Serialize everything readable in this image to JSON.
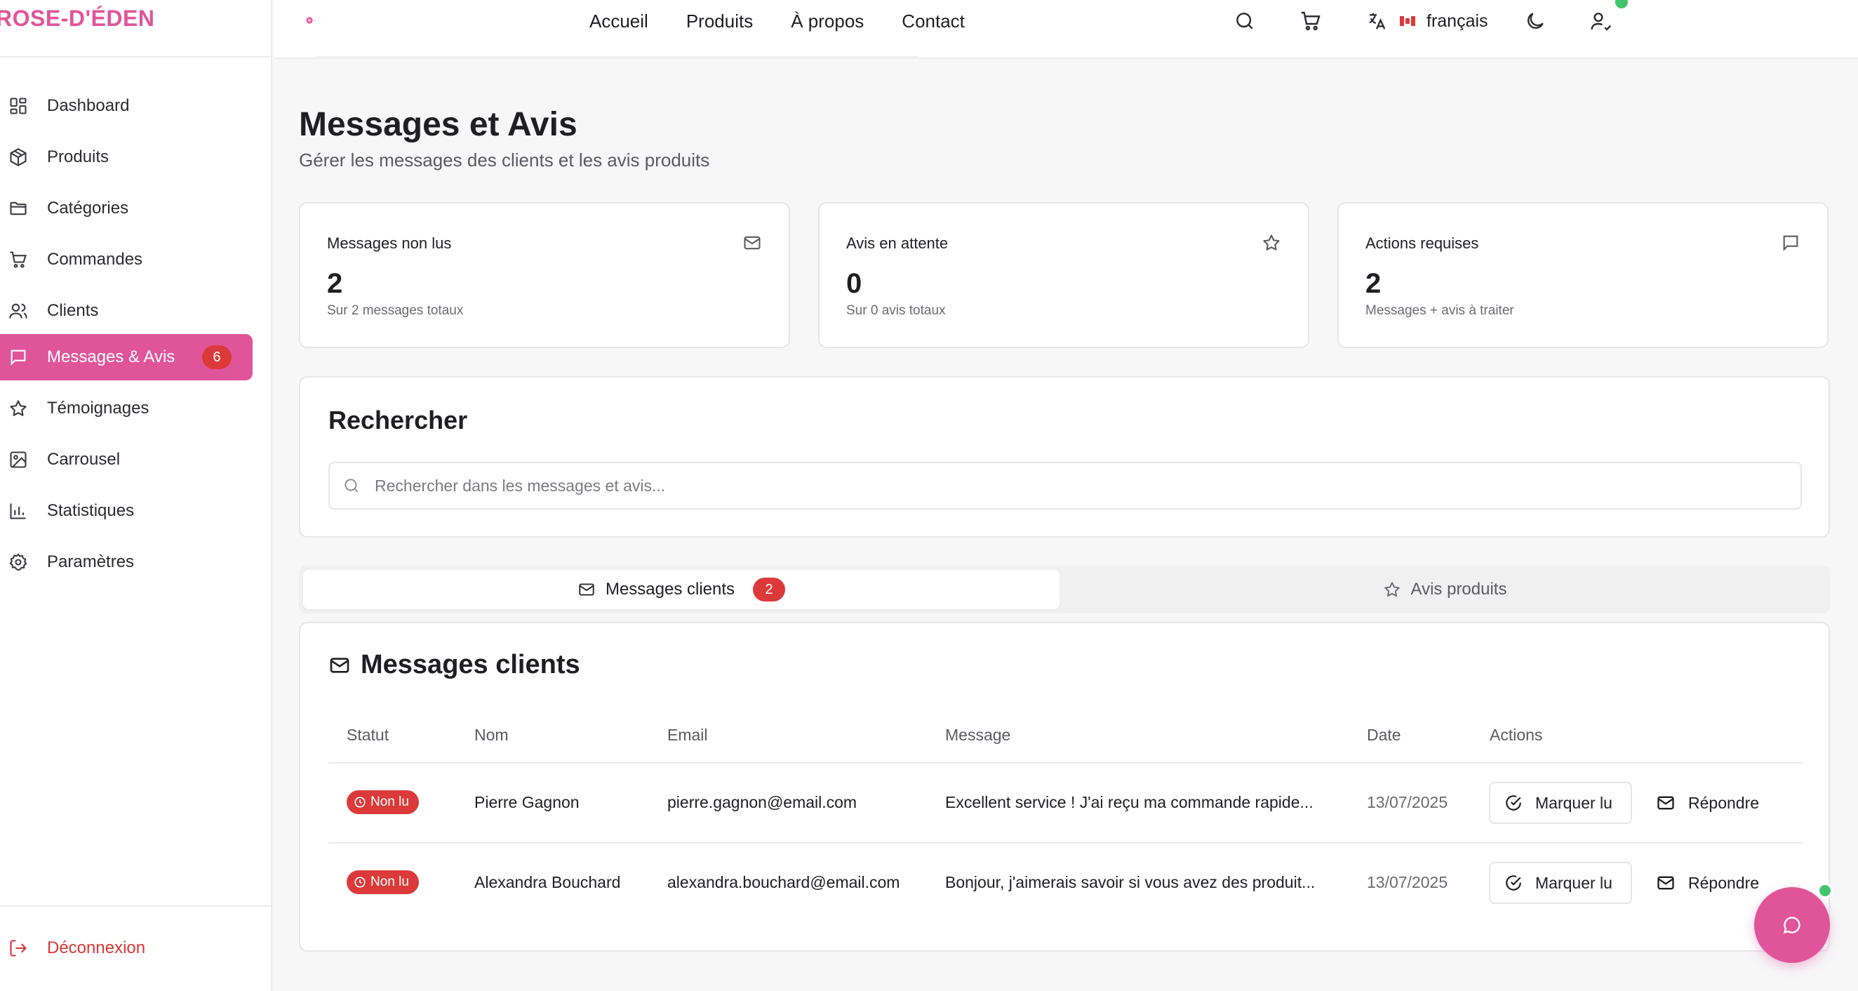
{
  "brand": {
    "name": "ROSE-D'ÉDEN",
    "color": "#e0559a"
  },
  "sidebar": {
    "items": [
      {
        "label": "Dashboard",
        "icon": "dashboard-grid-icon"
      },
      {
        "label": "Produits",
        "icon": "package-icon"
      },
      {
        "label": "Catégories",
        "icon": "folder-icon"
      },
      {
        "label": "Commandes",
        "icon": "cart-icon"
      },
      {
        "label": "Clients",
        "icon": "users-icon"
      },
      {
        "label": "Messages & Avis",
        "icon": "message-square-icon",
        "active": true,
        "badge": "6"
      },
      {
        "label": "Témoignages",
        "icon": "star-icon"
      },
      {
        "label": "Carrousel",
        "icon": "image-icon"
      },
      {
        "label": "Statistiques",
        "icon": "bar-chart-icon"
      },
      {
        "label": "Paramètres",
        "icon": "gear-icon"
      }
    ],
    "logout": {
      "label": "Déconnexion",
      "icon": "logout-icon",
      "color": "#d93636"
    }
  },
  "topbar": {
    "nav": [
      "Accueil",
      "Produits",
      "À propos",
      "Contact"
    ],
    "language": {
      "label": "français",
      "flag": "canada-flag-icon"
    },
    "icons": [
      "search-icon",
      "cart-icon",
      "translate-icon",
      "moon-icon",
      "user-check-icon"
    ]
  },
  "page": {
    "title": "Messages et Avis",
    "subtitle": "Gérer les messages des clients et les avis produits"
  },
  "stats": [
    {
      "title": "Messages non lus",
      "value": "2",
      "sub": "Sur 2 messages totaux",
      "icon": "mail-icon"
    },
    {
      "title": "Avis en attente",
      "value": "0",
      "sub": "Sur 0 avis totaux",
      "icon": "star-icon"
    },
    {
      "title": "Actions requises",
      "value": "2",
      "sub": "Messages + avis à traiter",
      "icon": "message-square-icon"
    }
  ],
  "search": {
    "title": "Rechercher",
    "placeholder": "Rechercher dans les messages et avis...",
    "value": ""
  },
  "tabs": [
    {
      "label": "Messages clients",
      "badge": "2",
      "active": true,
      "icon": "mail-icon"
    },
    {
      "label": "Avis produits",
      "active": false,
      "icon": "star-icon"
    }
  ],
  "messages": {
    "title": "Messages clients",
    "columns": [
      "Statut",
      "Nom",
      "Email",
      "Message",
      "Date",
      "Actions"
    ],
    "rows": [
      {
        "status": "Non lu",
        "name": "Pierre Gagnon",
        "email": "pierre.gagnon@email.com",
        "message": "Excellent service ! J'ai reçu ma commande rapide...",
        "date": "13/07/2025",
        "mark_label": "Marquer lu",
        "reply_label": "Répondre"
      },
      {
        "status": "Non lu",
        "name": "Alexandra Bouchard",
        "email": "alexandra.bouchard@email.com",
        "message": "Bonjour, j'aimerais savoir si vous avez des produit...",
        "date": "13/07/2025",
        "mark_label": "Marquer lu",
        "reply_label": "Répondre"
      }
    ]
  },
  "colors": {
    "accent": "#e0559a",
    "badge_red": "#dc3a3a",
    "online_green": "#43c46b"
  },
  "chat": {
    "icon": "chat-bubble-icon"
  }
}
